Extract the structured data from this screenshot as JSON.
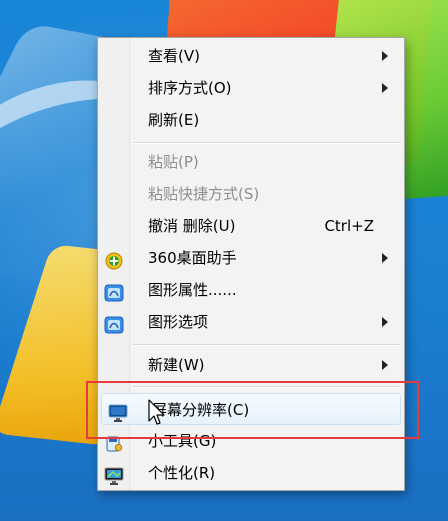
{
  "menu": {
    "items": [
      {
        "label": "查看(V)",
        "shortcut": "",
        "submenu": true,
        "disabled": false,
        "icon": null
      },
      {
        "label": "排序方式(O)",
        "shortcut": "",
        "submenu": true,
        "disabled": false,
        "icon": null
      },
      {
        "label": "刷新(E)",
        "shortcut": "",
        "submenu": false,
        "disabled": false,
        "icon": null
      },
      {
        "label": "粘贴(P)",
        "shortcut": "",
        "submenu": false,
        "disabled": true,
        "icon": null
      },
      {
        "label": "粘贴快捷方式(S)",
        "shortcut": "",
        "submenu": false,
        "disabled": true,
        "icon": null
      },
      {
        "label": "撤消 删除(U)",
        "shortcut": "Ctrl+Z",
        "submenu": false,
        "disabled": false,
        "icon": null
      },
      {
        "label": "360桌面助手",
        "shortcut": "",
        "submenu": true,
        "disabled": false,
        "icon": "360-assistant-icon"
      },
      {
        "label": "图形属性......",
        "shortcut": "",
        "submenu": false,
        "disabled": false,
        "icon": "graphics-properties-icon"
      },
      {
        "label": "图形选项",
        "shortcut": "",
        "submenu": true,
        "disabled": false,
        "icon": "graphics-options-icon"
      },
      {
        "label": "新建(W)",
        "shortcut": "",
        "submenu": true,
        "disabled": false,
        "icon": null
      },
      {
        "label": "屏幕分辨率(C)",
        "shortcut": "",
        "submenu": false,
        "disabled": false,
        "icon": "screen-resolution-icon"
      },
      {
        "label": "小工具(G)",
        "shortcut": "",
        "submenu": false,
        "disabled": false,
        "icon": "gadgets-icon"
      },
      {
        "label": "个性化(R)",
        "shortcut": "",
        "submenu": false,
        "disabled": false,
        "icon": "personalize-icon"
      }
    ]
  },
  "colors": {
    "annotation_box": "#e53b3b",
    "menu_bg": "#f3f3f3",
    "disabled_text": "#8e8e8e"
  }
}
